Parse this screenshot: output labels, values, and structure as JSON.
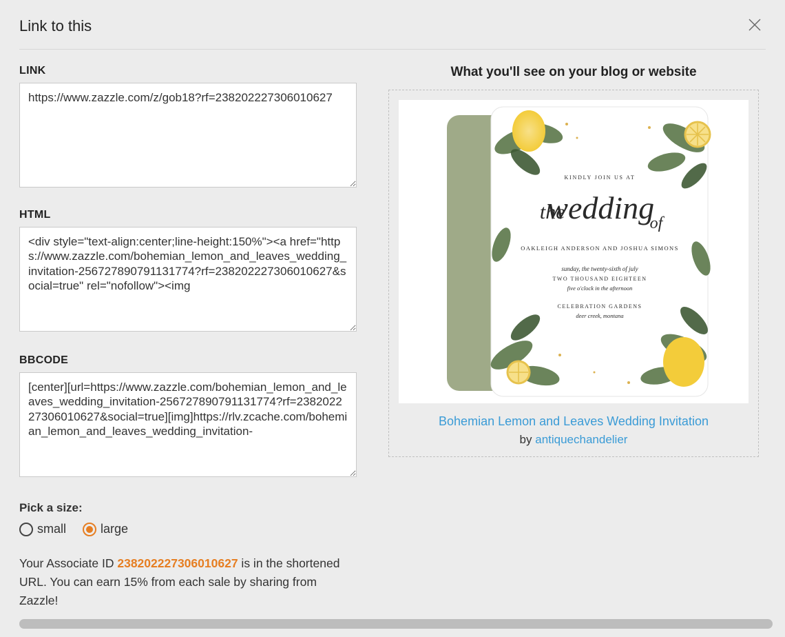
{
  "modal": {
    "title": "Link to this"
  },
  "left": {
    "link_label": "LINK",
    "link_value": "https://www.zazzle.com/z/gob18?rf=238202227306010627",
    "html_label": "HTML",
    "html_value": "<div style=\"text-align:center;line-height:150%\"><a href=\"https://www.zazzle.com/bohemian_lemon_and_leaves_wedding_invitation-256727890791131774?rf=238202227306010627&social=true\" rel=\"nofollow\"><img",
    "bb_label": "BBCODE",
    "bb_value": "[center][url=https://www.zazzle.com/bohemian_lemon_and_leaves_wedding_invitation-256727890791131774?rf=238202227306010627&social=true][img]https://rlv.zcache.com/bohemian_lemon_and_leaves_wedding_invitation-",
    "pick_size_label": "Pick a size:",
    "size_small": "small",
    "size_large": "large",
    "selected_size": "large",
    "assoc_prefix": "Your Associate ID ",
    "assoc_id": "238202227306010627",
    "assoc_suffix": " is in the shortened URL. You can earn 15% from each sale by sharing from Zazzle!"
  },
  "right": {
    "heading": "What you'll see on your blog or website",
    "product_title": "Bohemian Lemon and Leaves Wedding Invitation",
    "by_text": "by ",
    "designer": "antiquechandelier",
    "card_text": {
      "kicker": "KINDLY JOIN US AT",
      "headline_the": "the",
      "headline_word": "wedding",
      "headline_of": "of",
      "names": "OAKLEIGH ANDERSON AND JOSHUA SIMONS",
      "date1": "sunday, the twenty-sixth of july",
      "date2": "TWO THOUSAND EIGHTEEN",
      "time": "five o'clock in the afternoon",
      "venue": "CELEBRATION GARDENS",
      "city": "deer creek, montana"
    }
  }
}
